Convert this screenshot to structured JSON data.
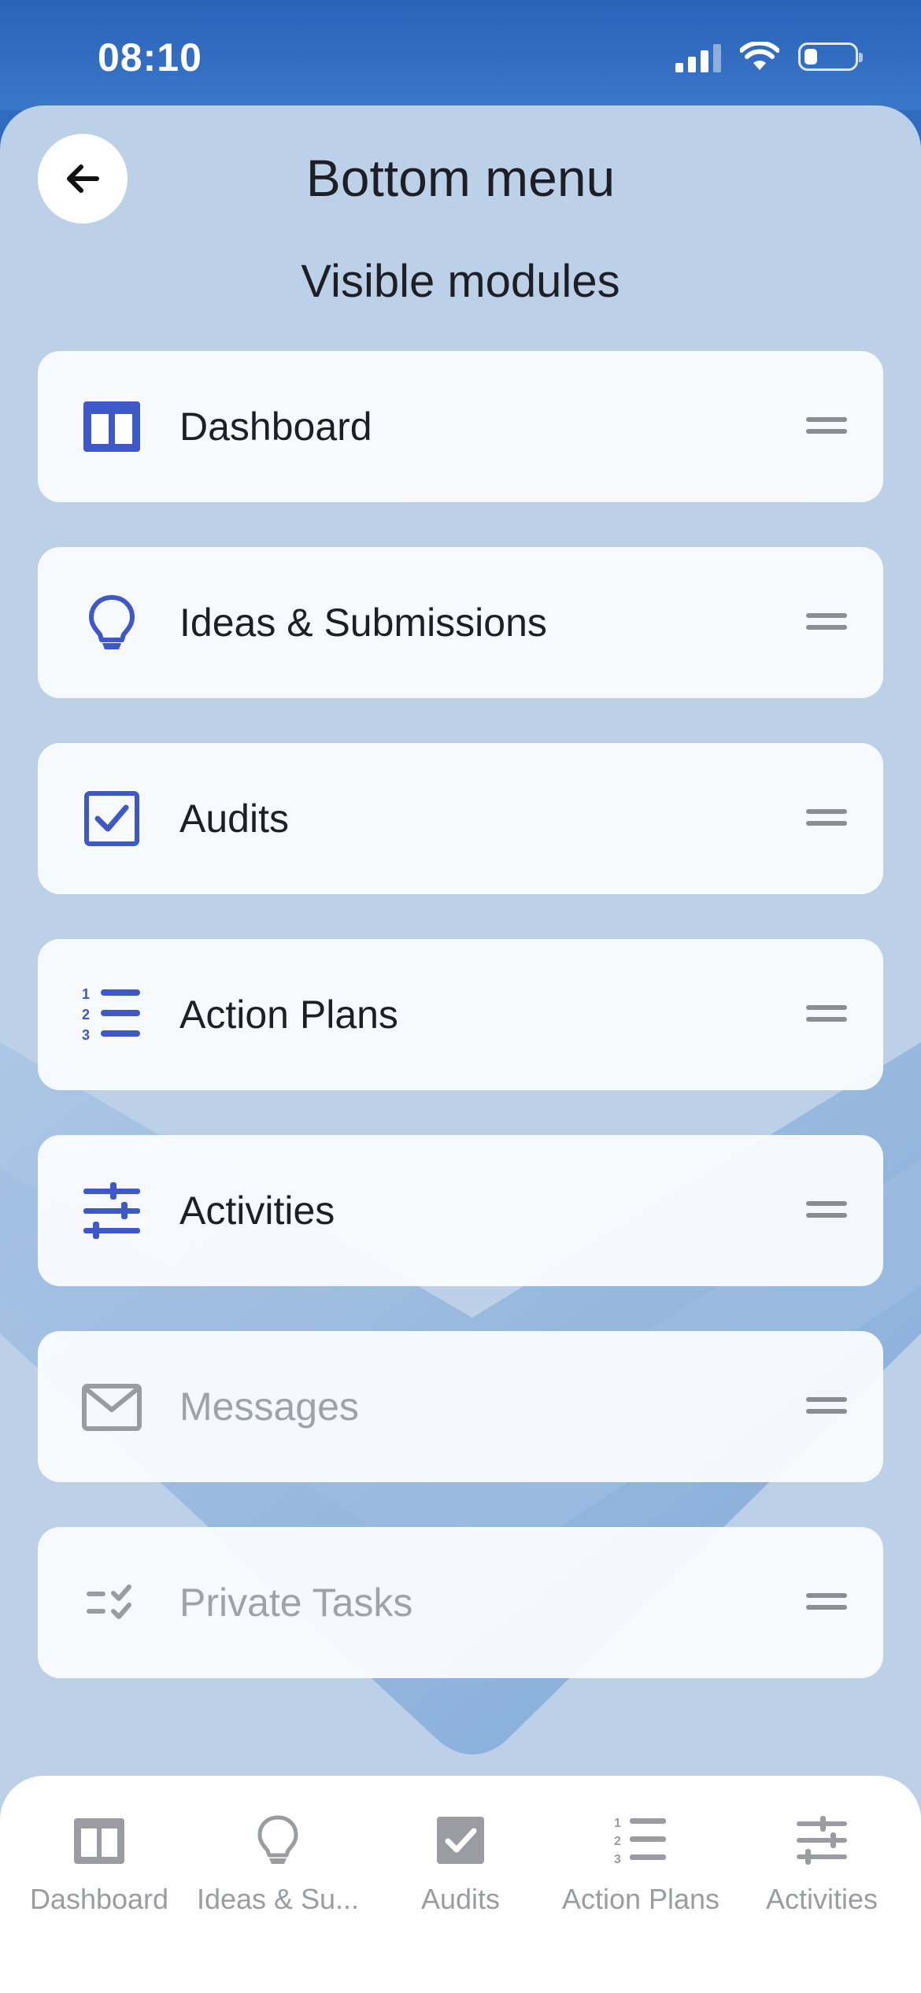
{
  "status_bar": {
    "time": "08:10",
    "battery_fraction": 0.25
  },
  "header": {
    "title": "Bottom menu",
    "back_icon": "arrow-left-icon"
  },
  "section": {
    "title": "Visible modules"
  },
  "modules": [
    {
      "label": "Dashboard",
      "icon": "columns-icon",
      "enabled": true
    },
    {
      "label": "Ideas & Submissions",
      "icon": "lightbulb-icon",
      "enabled": true
    },
    {
      "label": "Audits",
      "icon": "checkbox-icon",
      "enabled": true
    },
    {
      "label": "Action Plans",
      "icon": "numbered-list-icon",
      "enabled": true
    },
    {
      "label": "Activities",
      "icon": "sliders-icon",
      "enabled": true
    },
    {
      "label": "Messages",
      "icon": "envelope-icon",
      "enabled": false
    },
    {
      "label": "Private Tasks",
      "icon": "task-list-icon",
      "enabled": false
    }
  ],
  "bottom_nav": {
    "items": [
      {
        "label": "Dashboard",
        "icon": "columns-icon"
      },
      {
        "label": "Ideas & Su...",
        "icon": "lightbulb-icon"
      },
      {
        "label": "Audits",
        "icon": "checkbox-icon"
      },
      {
        "label": "Action Plans",
        "icon": "numbered-list-icon"
      },
      {
        "label": "Activities",
        "icon": "sliders-icon"
      }
    ]
  },
  "colors": {
    "accent": "#3f58c8",
    "disabled_icon": "#9a9ca2",
    "background": "#bcd1e8",
    "status_bar": "#2f6cc0",
    "card": "#fbfcfe",
    "handle": "#8a8d93"
  }
}
